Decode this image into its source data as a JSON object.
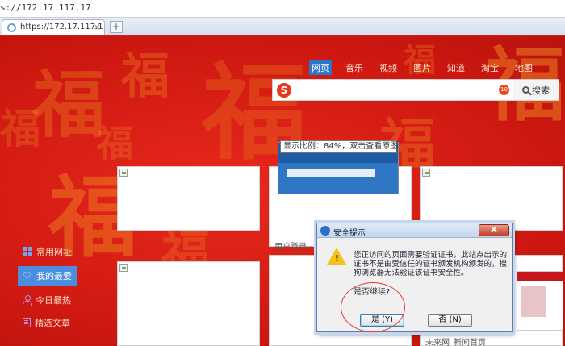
{
  "browser": {
    "address": "s://172.17.117.17",
    "tab_title": "https://172.17.117.1",
    "tab_close": "×",
    "new_tab": "+"
  },
  "search": {
    "tabs": [
      {
        "label": "网页",
        "active": true
      },
      {
        "label": "音乐",
        "active": false
      },
      {
        "label": "视频",
        "active": false
      },
      {
        "label": "图片",
        "active": false
      },
      {
        "label": "知道",
        "active": false
      },
      {
        "label": "淘宝",
        "active": false
      },
      {
        "label": "地图",
        "active": false
      }
    ],
    "logo": "S",
    "mini_icon": "10",
    "query": "",
    "button": "搜索"
  },
  "tiles": {
    "zoom_tip": "显示比例：84%，双击查看原图",
    "caption_login": "用户登录--",
    "caption_news": "未来网_新闻首页"
  },
  "left_nav": [
    {
      "label": "常用网址",
      "icon": "grid-icon",
      "active": false
    },
    {
      "label": "我的最爱",
      "icon": "heart-icon",
      "active": true
    },
    {
      "label": "今日最热",
      "icon": "user-icon",
      "active": false
    },
    {
      "label": "精选文章",
      "icon": "document-icon",
      "active": false
    }
  ],
  "dialog": {
    "title": "安全提示",
    "close": "X",
    "message": "您正访问的页面需要验证证书，此站点出示的证书不是由受信任的证书颁发机构颁发的，搜狗浏览器无法验证该证书安全性。",
    "question": "是否继续?",
    "yes": "是 (Y)",
    "no": "否 (N)"
  },
  "background": {
    "chars": [
      "福",
      "福",
      "福",
      "福",
      "福",
      "福",
      "福",
      "福",
      "福",
      "福"
    ]
  },
  "colors": {
    "page_red": "#d61a14",
    "accent_blue": "#4b8ee0",
    "warning": "#f3c317"
  }
}
